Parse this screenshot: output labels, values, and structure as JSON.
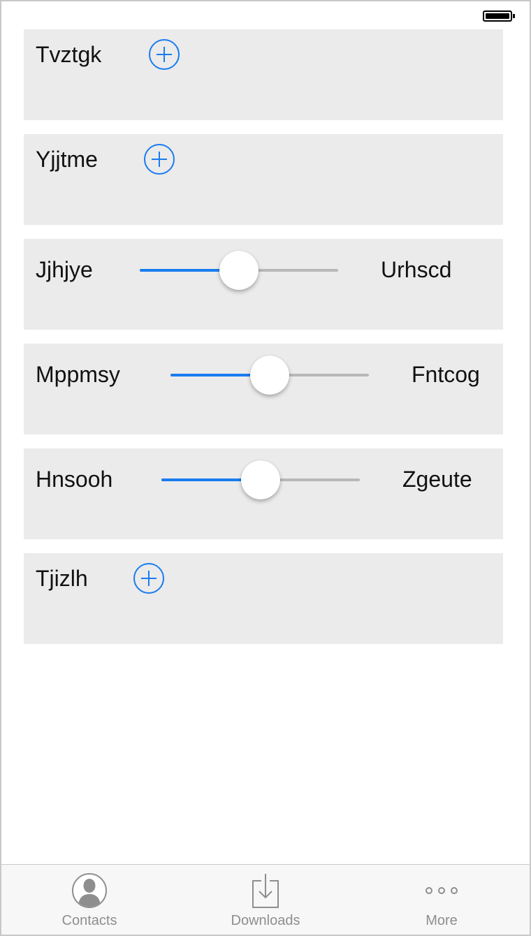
{
  "colors": {
    "accent": "#1a7cf0",
    "row_bg": "#ebebeb",
    "tab_inactive": "#8e8e8e"
  },
  "rows": [
    {
      "type": "add",
      "label": "Tvztgk"
    },
    {
      "type": "add",
      "label": "Yjjtme"
    },
    {
      "type": "slider",
      "label": "Jjhjye",
      "right_label": "Urhscd",
      "value": 0.5
    },
    {
      "type": "slider",
      "label": "Mppmsy",
      "right_label": "Fntcog",
      "value": 0.5
    },
    {
      "type": "slider",
      "label": "Hnsooh",
      "right_label": "Zgeute",
      "value": 0.5
    },
    {
      "type": "add",
      "label": "Tjizlh"
    }
  ],
  "tabs": [
    {
      "label": "Contacts",
      "icon": "contacts-icon"
    },
    {
      "label": "Downloads",
      "icon": "downloads-icon"
    },
    {
      "label": "More",
      "icon": "more-icon"
    }
  ]
}
